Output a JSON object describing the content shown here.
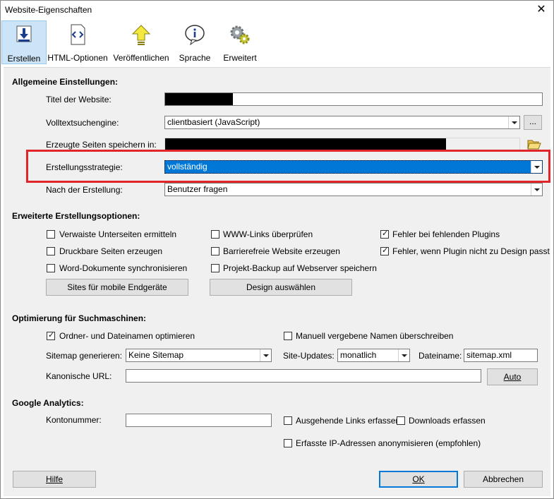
{
  "window": {
    "title": "Website-Eigenschaften",
    "close_glyph": "✕"
  },
  "toolbar": {
    "items": [
      {
        "label": "Erstellen",
        "icon": "build-download-icon",
        "active": true
      },
      {
        "label": "HTML-Optionen",
        "icon": "html-code-icon"
      },
      {
        "label": "Veröffentlichen",
        "icon": "publish-up-arrow-icon"
      },
      {
        "label": "Sprache",
        "icon": "info-speech-icon"
      },
      {
        "label": "Erweitert",
        "icon": "gears-icon"
      }
    ]
  },
  "general": {
    "heading": "Allgemeine Einstellungen:",
    "title_label": "Titel der Website:",
    "search_label": "Volltextsuchengine:",
    "search_value": "clientbasiert (JavaScript)",
    "search_browse": "...",
    "save_label": "Erzeugte Seiten speichern in:",
    "strategy_label": "Erstellungsstrategie:",
    "strategy_value": "vollständig",
    "after_label": "Nach der Erstellung:",
    "after_value": "Benutzer fragen"
  },
  "advanced": {
    "heading": "Erweiterte Erstellungsoptionen:",
    "checkboxes": [
      {
        "label": "Verwaiste Unterseiten ermitteln",
        "checked": false
      },
      {
        "label": "Druckbare Seiten erzeugen",
        "checked": false
      },
      {
        "label": "Word-Dokumente synchronisieren",
        "checked": false
      },
      {
        "label": "WWW-Links überprüfen",
        "checked": false
      },
      {
        "label": "Barrierefreie Website erzeugen",
        "checked": false
      },
      {
        "label": "Projekt-Backup auf Webserver speichern",
        "checked": false
      },
      {
        "label": "Fehler bei fehlenden Plugins",
        "checked": true
      },
      {
        "label": "Fehler, wenn Plugin nicht zu Design passt",
        "checked": true
      }
    ],
    "mobile_button": "Sites für mobile Endgeräte",
    "design_button": "Design auswählen"
  },
  "seo": {
    "heading": "Optimierung für Suchmaschinen:",
    "optimize_label": "Ordner- und Dateinamen optimieren",
    "optimize_checked": true,
    "overwrite_label": "Manuell vergebene Namen überschreiben",
    "overwrite_checked": false,
    "sitemap_label": "Sitemap generieren:",
    "sitemap_value": "Keine Sitemap",
    "updates_label": "Site-Updates:",
    "updates_value": "monatlich",
    "filename_label": "Dateiname:",
    "filename_value": "sitemap.xml",
    "canonical_label": "Kanonische URL:",
    "canonical_value": "",
    "auto_button": "Auto"
  },
  "analytics": {
    "heading": "Google Analytics:",
    "account_label": "Kontonummer:",
    "account_value": "",
    "outgoing_label": "Ausgehende Links erfassen",
    "outgoing_checked": false,
    "downloads_label": "Downloads erfassen",
    "downloads_checked": false,
    "anonymize_label": "Erfasste IP-Adressen anonymisieren (empfohlen)",
    "anonymize_checked": false
  },
  "footer": {
    "help": "Hilfe",
    "ok": "OK",
    "cancel": "Abbrechen"
  },
  "colors": {
    "highlight": "#e0262b",
    "selection": "#0078d7",
    "panel": "#f0f0f0"
  }
}
